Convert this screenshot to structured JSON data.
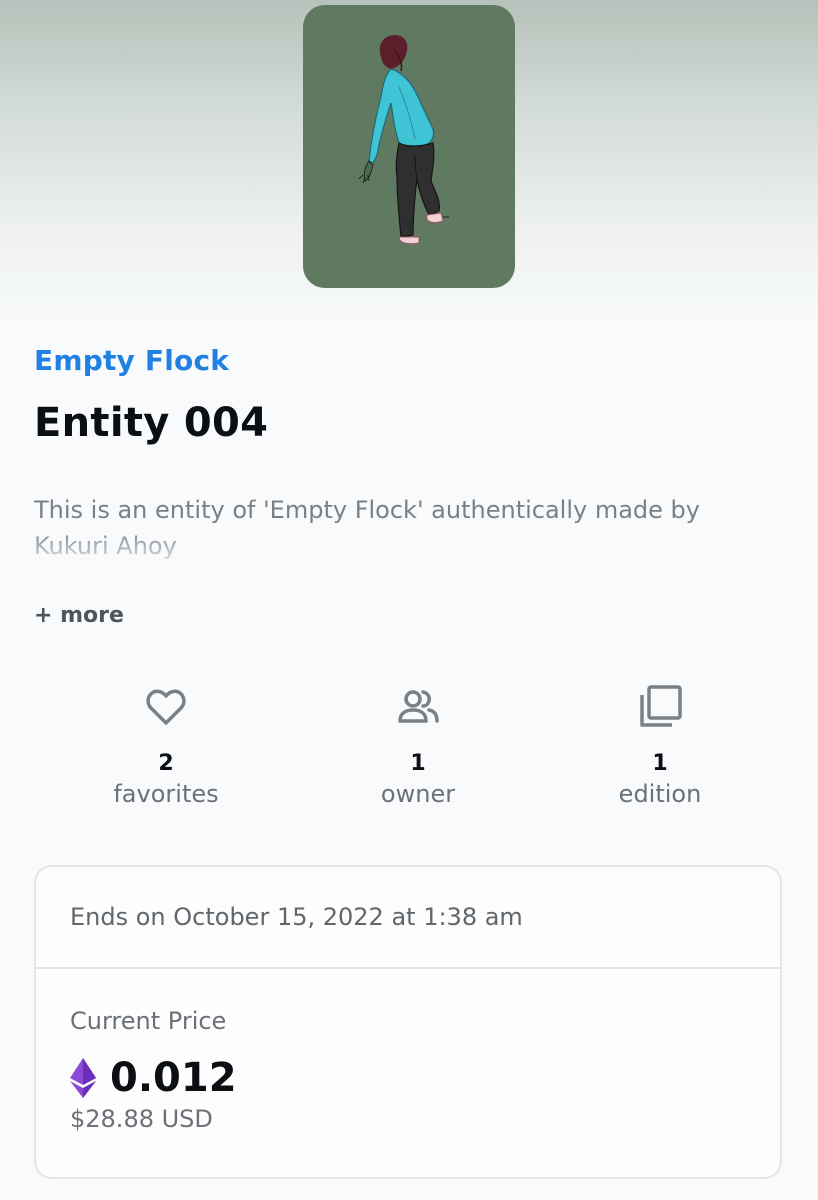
{
  "collection": {
    "name": "Empty Flock"
  },
  "item": {
    "title": "Entity 004",
    "description": "This is an entity of 'Empty Flock' authentically made by Kukuri Ahoy",
    "more_label": "+ more"
  },
  "stats": {
    "favorites": {
      "count": "2",
      "label": "favorites",
      "icon": "heart-icon"
    },
    "owners": {
      "count": "1",
      "label": "owner",
      "icon": "people-icon"
    },
    "editions": {
      "count": "1",
      "label": "edition",
      "icon": "stack-icon"
    }
  },
  "auction": {
    "ends_text": "Ends on October 15, 2022 at 1:38 am",
    "price_label": "Current Price",
    "price": "0.012",
    "currency_icon": "ethereum-icon",
    "usd": "$28.88 USD"
  },
  "colors": {
    "link": "#2081e2",
    "artwork_bg": "#5f7a61",
    "eth_icon": "#8a4ad8"
  }
}
